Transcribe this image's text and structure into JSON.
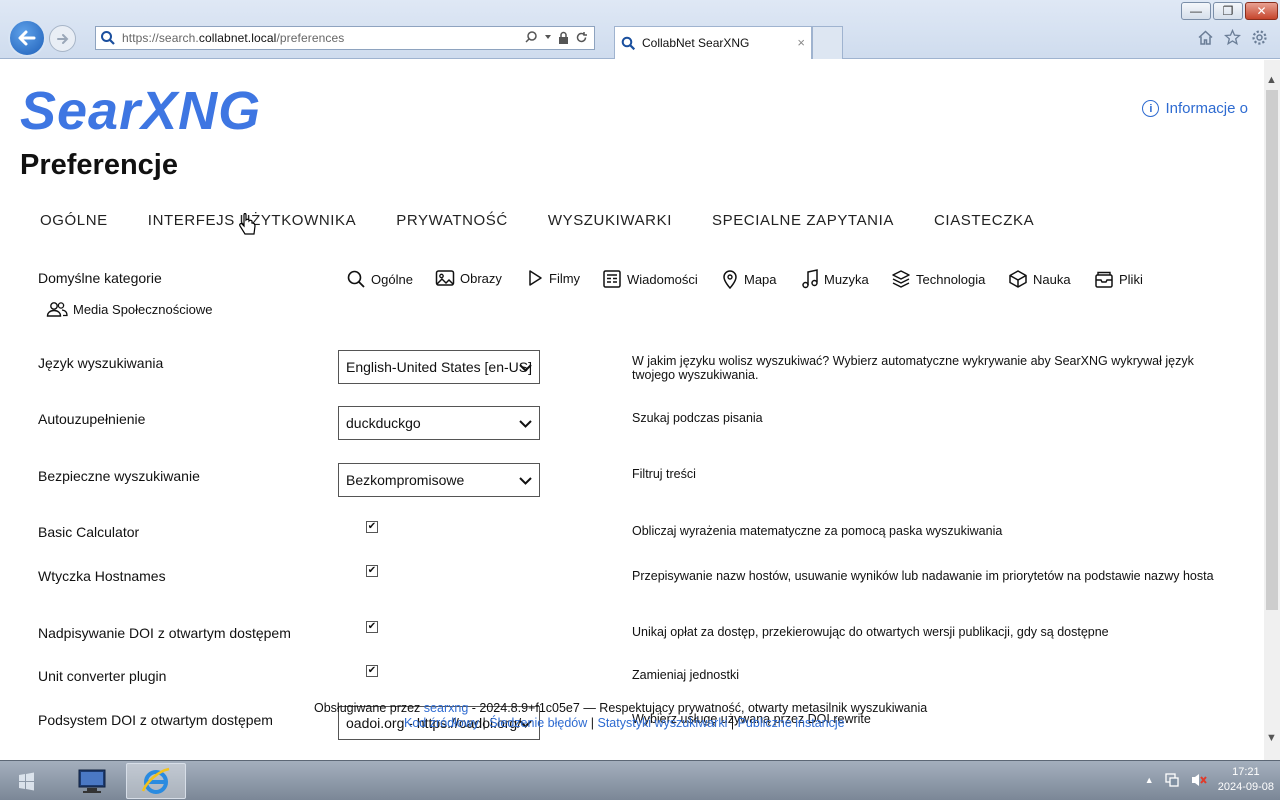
{
  "browser": {
    "url_prefix": "https://search.",
    "url_domain": "collabnet.local",
    "url_path": "/preferences",
    "tab_title": "CollabNet SearXNG",
    "tab_close": "×",
    "win_min": "—",
    "win_max": "❐",
    "win_close": "✕"
  },
  "page": {
    "logo": "SearXNG",
    "about": "Informacje o",
    "title": "Preferencje"
  },
  "tabs": [
    "OGÓLNE",
    "INTERFEJS UŻYTKOWNIKA",
    "PRYWATNOŚĆ",
    "WYSZUKIWARKI",
    "SPECIALNE ZAPYTANIA",
    "CIASTECZKA"
  ],
  "categories": {
    "label": "Domyślne kategorie",
    "items": [
      {
        "label": "Ogólne",
        "icon": "search-icon"
      },
      {
        "label": "Obrazy",
        "icon": "image-icon"
      },
      {
        "label": "Filmy",
        "icon": "play-icon"
      },
      {
        "label": "Wiadomości",
        "icon": "news-icon"
      },
      {
        "label": "Mapa",
        "icon": "map-pin-icon"
      },
      {
        "label": "Muzyka",
        "icon": "music-icon"
      },
      {
        "label": "Technologia",
        "icon": "layers-icon"
      },
      {
        "label": "Nauka",
        "icon": "cube-icon"
      },
      {
        "label": "Pliki",
        "icon": "files-icon"
      },
      {
        "label": "Media Społecznościowe",
        "icon": "people-icon"
      }
    ]
  },
  "settings": {
    "language": {
      "label": "Język wyszukiwania",
      "value": "English-United States [en-US]",
      "desc": "W jakim języku wolisz wyszukiwać? Wybierz automatyczne wykrywanie aby SearXNG wykrywał język twojego wyszukiwania."
    },
    "autocomplete": {
      "label": "Autouzupełnienie",
      "value": "duckduckgo",
      "desc": "Szukaj podczas pisania"
    },
    "safesearch": {
      "label": "Bezpieczne wyszukiwanie",
      "value": "Bezkompromisowe",
      "desc": "Filtruj treści"
    },
    "calculator": {
      "label": "Basic Calculator",
      "checked": true,
      "desc": "Obliczaj wyrażenia matematyczne za pomocą paska wyszukiwania"
    },
    "hostnames": {
      "label": "Wtyczka Hostnames",
      "checked": true,
      "desc": "Przepisywanie nazw hostów, usuwanie wyników lub nadawanie im priorytetów na podstawie nazwy hosta"
    },
    "doi_rewrite": {
      "label": "Nadpisywanie DOI z otwartym dostępem",
      "checked": true,
      "desc": "Unikaj opłat za dostęp, przekierowując do otwartych wersji publikacji, gdy są dostępne"
    },
    "unit_converter": {
      "label": "Unit converter plugin",
      "checked": true,
      "desc": "Zamieniaj jednostki"
    },
    "doi_resolver": {
      "label": "Podsystem DOI z otwartym dostępem",
      "value": "oadoi.org - https://oadoi.org/",
      "desc": "Wybierz usługę używaną przez DOI rewrite"
    }
  },
  "footer": {
    "powered_by": "Obsługiwane przez",
    "searxng_link": "searxng",
    "version_text": "- 2024.8.9+f1c05e7 — Respektujący prywatność, otwarty metasilnik wyszukiwania",
    "links": [
      "Kod źródłowy",
      "Śledzenie błędów",
      "Statystyki wyszukiwarki",
      "Publiczne instancje"
    ],
    "sep": "|"
  },
  "taskbar": {
    "time": "17:21",
    "date": "2024-09-08"
  },
  "colors": {
    "accent": "#3e76e2",
    "link": "#2e6bd1"
  }
}
